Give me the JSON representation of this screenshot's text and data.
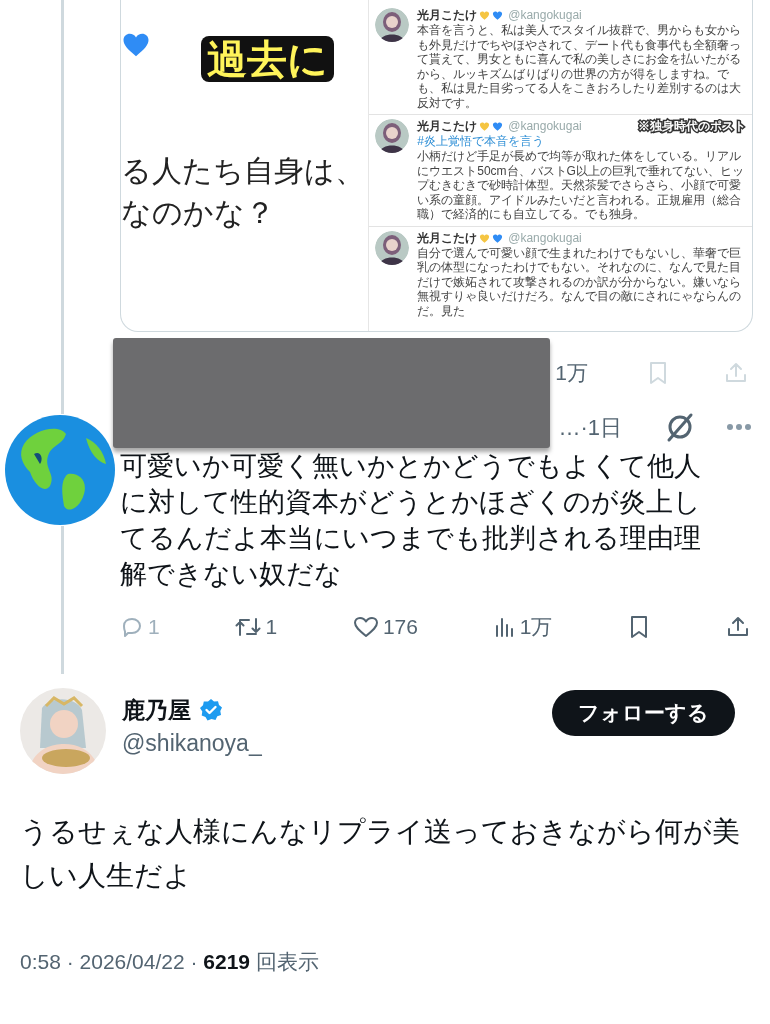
{
  "quoted_image": {
    "caption": "過去に",
    "left_text": [
      "る人たち自身は、",
      "なのかな？"
    ],
    "posts": [
      {
        "name": "光月こたけ",
        "handle": "@kangokugai",
        "text": "本音を言うと、私は美人でスタイル抜群で、男からも女からも外見だけでちやほやされて、デート代も食事代も全額奢って貰えて、男女ともに喜んで私の美しさにお金を払いたがるから、ルッキズムばりばりの世界の方が得をしますね。でも、私は見た目劣ってる人をこきおろしたり差別するのは大反対です。"
      },
      {
        "name": "光月こたけ",
        "handle": "@kangokugai",
        "note": "※独身時代のポスト",
        "hashtag": "#炎上覚悟で本音を言う",
        "text": "小柄だけど手足が長めで均等が取れた体をしている。リアルにウエスト50cm台、バストG以上の巨乳で垂れてない、ヒップむきむきで砂時計体型。天然茶髪でさらさら、小顔で可愛い系の童顔。アイドルみたいだと言われる。正規雇用（総合職）で経済的にも自立してる。でも独身。"
      },
      {
        "name": "光月こたけ",
        "handle": "@kangokugai",
        "text": "自分で選んで可愛い顔で生まれたわけでもないし、華奢で巨乳の体型になったわけでもない。それなのに、なんで見た目だけで嫉妬されて攻撃されるのか訳が分からない。嫌いなら無視すりゃ良いだけだろ。なんで目の敵にされにゃならんのだ。見た"
      }
    ]
  },
  "previous_tweet_actions": {
    "views": "1万"
  },
  "reply": {
    "time": "…·1日",
    "text": "可愛いか可愛く無いかとかどうでもよくて他人に対して性的資本がどうとかほざくのが炎上してるんだよ本当にいつまでも批判される理由理解できない奴だな",
    "actions": {
      "replies": "1",
      "replies_disabled": true,
      "retweets": "1",
      "likes": "176",
      "views": "1万"
    }
  },
  "main_tweet": {
    "name": "鹿乃屋",
    "verified": true,
    "handle": "@shikanoya_",
    "follow_button": "フォローする",
    "text": "うるせぇな人様にんなリプライ送っておきながら何が美しい人生だよ",
    "footer": "0:58 · 2026/04/22 · **6219** 回表示"
  }
}
